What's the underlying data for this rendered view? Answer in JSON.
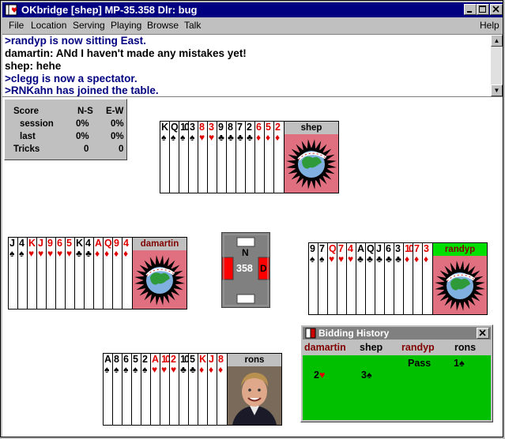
{
  "window": {
    "title": "OKbridge [shep]   MP-35.358   Dlr: bug"
  },
  "menu": {
    "file": "File",
    "location": "Location",
    "serving": "Serving",
    "playing": "Playing",
    "browse": "Browse",
    "talk": "Talk",
    "help": "Help"
  },
  "chat": {
    "lines": [
      {
        "text": ">randyp is now sitting East.",
        "color": "#000080"
      },
      {
        "text": "damartin: ANd I haven't made any mistakes yet!",
        "color": "#000000"
      },
      {
        "text": "shep: hehe",
        "color": "#000000"
      },
      {
        "text": ">clegg is now a spectator.",
        "color": "#000080"
      },
      {
        "text": ">RNKahn has joined the table.",
        "color": "#000080"
      }
    ]
  },
  "score": {
    "title": "Score",
    "ns": "N-S",
    "ew": "E-W",
    "rows": [
      {
        "label": "session",
        "ns": "0%",
        "ew": "0%"
      },
      {
        "label": "last",
        "ns": "0%",
        "ew": "0%"
      },
      {
        "label": "Tricks",
        "ns": "0",
        "ew": "0"
      }
    ]
  },
  "players": {
    "north": {
      "name": "shep",
      "cards": [
        {
          "r": "K",
          "s": "♠",
          "red": false
        },
        {
          "r": "Q",
          "s": "♠",
          "red": false
        },
        {
          "r": "10",
          "s": "♠",
          "red": false
        },
        {
          "r": "3",
          "s": "♠",
          "red": false
        },
        {
          "r": "8",
          "s": "♥",
          "red": true
        },
        {
          "r": "3",
          "s": "♥",
          "red": true
        },
        {
          "r": "9",
          "s": "♣",
          "red": false
        },
        {
          "r": "8",
          "s": "♣",
          "red": false
        },
        {
          "r": "7",
          "s": "♣",
          "red": false
        },
        {
          "r": "2",
          "s": "♣",
          "red": false
        },
        {
          "r": "6",
          "s": "♦",
          "red": true
        },
        {
          "r": "5",
          "s": "♦",
          "red": true
        },
        {
          "r": "2",
          "s": "♦",
          "red": true
        }
      ]
    },
    "west": {
      "name": "damartin",
      "cards": [
        {
          "r": "J",
          "s": "♠",
          "red": false
        },
        {
          "r": "4",
          "s": "♠",
          "red": false
        },
        {
          "r": "K",
          "s": "♥",
          "red": true
        },
        {
          "r": "J",
          "s": "♥",
          "red": true
        },
        {
          "r": "9",
          "s": "♥",
          "red": true
        },
        {
          "r": "6",
          "s": "♥",
          "red": true
        },
        {
          "r": "5",
          "s": "♥",
          "red": true
        },
        {
          "r": "K",
          "s": "♣",
          "red": false
        },
        {
          "r": "4",
          "s": "♣",
          "red": false
        },
        {
          "r": "A",
          "s": "♦",
          "red": true
        },
        {
          "r": "Q",
          "s": "♦",
          "red": true
        },
        {
          "r": "9",
          "s": "♦",
          "red": true
        },
        {
          "r": "4",
          "s": "♦",
          "red": true
        }
      ]
    },
    "east": {
      "name": "randyp",
      "cards": [
        {
          "r": "9",
          "s": "♠",
          "red": false
        },
        {
          "r": "7",
          "s": "♠",
          "red": false
        },
        {
          "r": "Q",
          "s": "♥",
          "red": true
        },
        {
          "r": "7",
          "s": "♥",
          "red": true
        },
        {
          "r": "4",
          "s": "♥",
          "red": true
        },
        {
          "r": "A",
          "s": "♣",
          "red": false
        },
        {
          "r": "Q",
          "s": "♣",
          "red": false
        },
        {
          "r": "J",
          "s": "♣",
          "red": false
        },
        {
          "r": "6",
          "s": "♣",
          "red": false
        },
        {
          "r": "3",
          "s": "♣",
          "red": false
        },
        {
          "r": "10",
          "s": "♦",
          "red": true
        },
        {
          "r": "7",
          "s": "♦",
          "red": true
        },
        {
          "r": "3",
          "s": "♦",
          "red": true
        }
      ]
    },
    "south": {
      "name": "rons",
      "cards": [
        {
          "r": "A",
          "s": "♠",
          "red": false
        },
        {
          "r": "8",
          "s": "♠",
          "red": false
        },
        {
          "r": "6",
          "s": "♠",
          "red": false
        },
        {
          "r": "5",
          "s": "♠",
          "red": false
        },
        {
          "r": "2",
          "s": "♠",
          "red": false
        },
        {
          "r": "A",
          "s": "♥",
          "red": true
        },
        {
          "r": "10",
          "s": "♥",
          "red": true
        },
        {
          "r": "2",
          "s": "♥",
          "red": true
        },
        {
          "r": "10",
          "s": "♣",
          "red": false
        },
        {
          "r": "5",
          "s": "♣",
          "red": false
        },
        {
          "r": "K",
          "s": "♦",
          "red": true
        },
        {
          "r": "J",
          "s": "♦",
          "red": true
        },
        {
          "r": "8",
          "s": "♦",
          "red": true
        }
      ]
    }
  },
  "compass": {
    "north": "N",
    "board": "358",
    "dealer": "D"
  },
  "bidding": {
    "title": "Bidding History",
    "headers": [
      "damartin",
      "shep",
      "randyp",
      "rons"
    ],
    "row1": [
      "",
      "",
      "Pass",
      "1♠"
    ],
    "row2": [
      "2♥",
      "3♠",
      "",
      ""
    ]
  },
  "colors": {
    "titlebar": "#000080",
    "table_green": "#00c000",
    "east_name_bg": "#00e000",
    "name_bg": "#c0c0c0",
    "avatar_bg": "#e07080",
    "red_suit": "#e00000",
    "bid_header": "#800000"
  },
  "icons": {
    "app": "bridge-app-icon",
    "minimize": "minimize-icon",
    "maximize": "maximize-icon",
    "close": "close-icon"
  }
}
